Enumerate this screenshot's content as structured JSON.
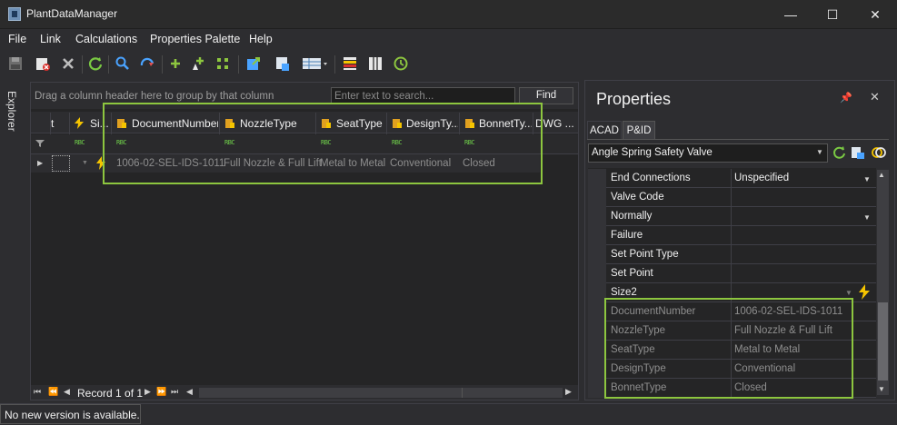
{
  "window": {
    "title": "PlantDataManager",
    "minimize": "—",
    "maximize": "☐",
    "close": "✕"
  },
  "menu": [
    "File",
    "Link",
    "Calculations",
    "Properties Palette",
    "Help"
  ],
  "toolbar_icons": [
    "save-icon",
    "delete-record-icon",
    "cancel-icon",
    "refresh-icon",
    "find-icon",
    "sync-icon",
    "add-icon",
    "add-tag-icon",
    "grid-icon",
    "export-icon",
    "import-icon",
    "view-options-icon",
    "color-bands-icon",
    "columns-icon",
    "history-icon"
  ],
  "explorer": {
    "label": "Explorer"
  },
  "grid": {
    "group_hint": "Drag a column header here to group by that column",
    "search_placeholder": "Enter text to search...",
    "find_label": "Find",
    "columns": [
      "t",
      "Si...",
      "DocumentNumber",
      "NozzleType",
      "SeatType",
      "DesignTy...",
      "BonnetTy...",
      "DWG ..."
    ],
    "row": {
      "DocumentNumber": "1006-02-SEL-IDS-1011",
      "NozzleType": "Full Nozzle & Full Lift",
      "SeatType": "Metal to Metal",
      "DesignType": "Conventional",
      "BonnetType": "Closed"
    },
    "record_label": "Record 1 of 1"
  },
  "properties": {
    "title": "Properties",
    "tabs": [
      "ACAD",
      "P&ID"
    ],
    "selected_type": "Angle Spring Safety Valve",
    "rows": [
      {
        "name": "End Connections",
        "value": "Unspecified"
      },
      {
        "name": "Valve Code",
        "value": ""
      },
      {
        "name": "Normally",
        "value": ""
      },
      {
        "name": "Failure",
        "value": ""
      },
      {
        "name": "Set Point Type",
        "value": ""
      },
      {
        "name": "Set Point",
        "value": ""
      },
      {
        "name": "Size2",
        "value": ""
      },
      {
        "name": "DocumentNumber",
        "value": "1006-02-SEL-IDS-1011"
      },
      {
        "name": "NozzleType",
        "value": "Full Nozzle & Full Lift"
      },
      {
        "name": "SeatType",
        "value": "Metal to Metal"
      },
      {
        "name": "DesignType",
        "value": "Conventional"
      },
      {
        "name": "BonnetType",
        "value": "Closed"
      }
    ]
  },
  "status": {
    "text": "No new version is available."
  },
  "colors": {
    "highlight": "#8dc63f",
    "background": "#2d2d30",
    "accent_green": "#6fcf4a",
    "lightning": "#f5c400"
  }
}
